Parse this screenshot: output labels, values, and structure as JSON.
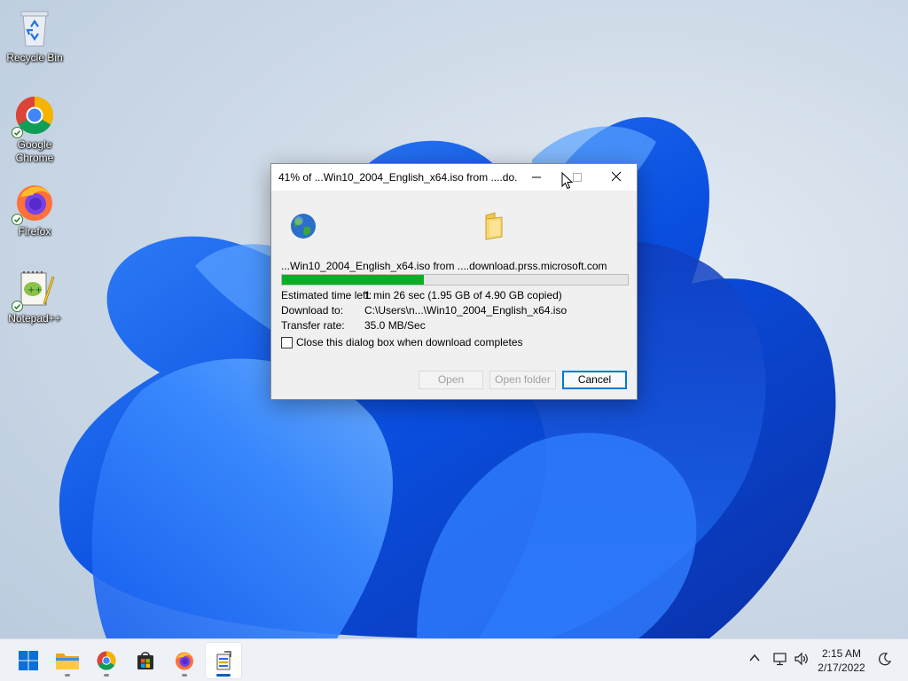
{
  "desktop": {
    "icons": [
      {
        "label": "Recycle Bin",
        "icon": "recycle-bin-icon"
      },
      {
        "label": "Google Chrome",
        "icon": "chrome-icon",
        "label_lines": [
          "Google",
          "Chrome"
        ]
      },
      {
        "label": "Firefox",
        "icon": "firefox-icon"
      },
      {
        "label": "Notepad++",
        "icon": "notepad-plus-plus-icon"
      }
    ]
  },
  "dialog": {
    "title": "41% of ...Win10_2004_English_x64.iso from ....do...",
    "file_line": "...Win10_2004_English_x64.iso from ....download.prss.microsoft.com",
    "progress": 0.41,
    "estimated_label": "Estimated time left:",
    "estimated_value": "1 min 26 sec (1.95 GB of 4.90 GB copied)",
    "download_to_label": "Download to:",
    "download_to_value": "C:\\Users\\n...\\Win10_2004_English_x64.iso",
    "transfer_rate_label": "Transfer rate:",
    "transfer_rate_value": "35.0 MB/Sec",
    "checkbox_label": "Close this dialog box when download completes",
    "checkbox_checked": false,
    "buttons": {
      "open": "Open",
      "open_folder": "Open folder",
      "cancel": "Cancel"
    },
    "colors": {
      "progress": "#06b025",
      "accent": "#0078d7"
    }
  },
  "taskbar": {
    "items": [
      {
        "name": "start-button",
        "icon": "windows-logo-icon"
      },
      {
        "name": "file-explorer",
        "icon": "folder-icon"
      },
      {
        "name": "chrome",
        "icon": "chrome-icon"
      },
      {
        "name": "microsoft-store",
        "icon": "store-icon"
      },
      {
        "name": "firefox",
        "icon": "firefox-icon"
      },
      {
        "name": "download-manager",
        "icon": "download-app-icon"
      }
    ],
    "clock_time": "2:15 AM",
    "clock_date": "2/17/2022"
  }
}
